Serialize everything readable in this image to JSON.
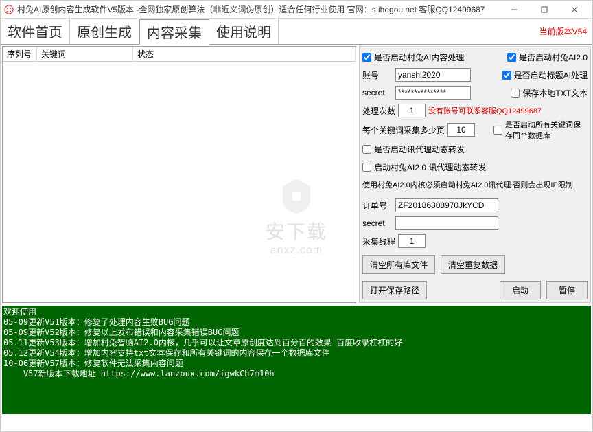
{
  "window": {
    "title": "村兔AI原创内容生成软件V5版本 -全网独家原创算法（非近义词伪原创）适合任何行业使用 官网：s.ihegou.net 客服QQ12499687"
  },
  "tabs": {
    "t1": "软件首页",
    "t2": "原创生成",
    "t3": "内容采集",
    "t4": "使用说明"
  },
  "version": "当前版本V54",
  "listHeader": {
    "c1": "序列号",
    "c2": "关键词",
    "c3": "状态"
  },
  "right": {
    "chk_ai_content": "是否启动村兔AI内容处理",
    "chk_ai20": "是否启动村兔AI2.0",
    "lbl_account": "账号",
    "val_account": "yanshi2020",
    "chk_title_ai": "是否启动标题AI处理",
    "lbl_secret": "secret",
    "val_secret": "***************",
    "chk_save_txt": "保存本地TXT文本",
    "lbl_count": "处理次数",
    "val_count": "1",
    "note_contact": "没有账号可联系客服QQ12499687",
    "lbl_pages": "每个关键词采集多少页",
    "val_pages": "10",
    "chk_keyword_db": "是否启动所有关键词保存同个数据库",
    "chk_proxy": "是否启动讯代理动态转发",
    "chk_ai20_proxy": "启动村兔AI2.0 讯代理动态转发",
    "note_ip": "使用村兔AI2.0内核必须启动村兔AI2.0讯代理 否则会出现IP限制",
    "lbl_order": "订单号",
    "val_order": "ZF20186808970JkYCD",
    "lbl_secret2": "secret",
    "val_secret2": "",
    "lbl_threads": "采集线程",
    "val_threads": "1",
    "btn_clear_lib": "清空所有库文件",
    "btn_clear_dup": "清空重复数据",
    "btn_open_path": "打开保存路径",
    "btn_start": "启动",
    "btn_pause": "暂停"
  },
  "log": "欢迎使用\n05-09更新V51版本：修复了处理内容生败BUG问题\n05-09更新V52版本：修复以上发布错误和内容采集错误BUG问题\n05.11更新V53版本：增加村兔智脑AI2.0内核，几乎可以让文章原创度达到百分百的效果 百度收录杠杠的好\n05.12更新V54版本：增加内容支持txt文本保存和所有关键词的内容保存一个数据库文件\n10-06更新V57版本：修复软件无法采集内容问题\n    V57新版本下载地址 https://www.lanzoux.com/igwkCh7m10h",
  "watermark": {
    "t1": "安下载",
    "t2": "anxz.com"
  }
}
